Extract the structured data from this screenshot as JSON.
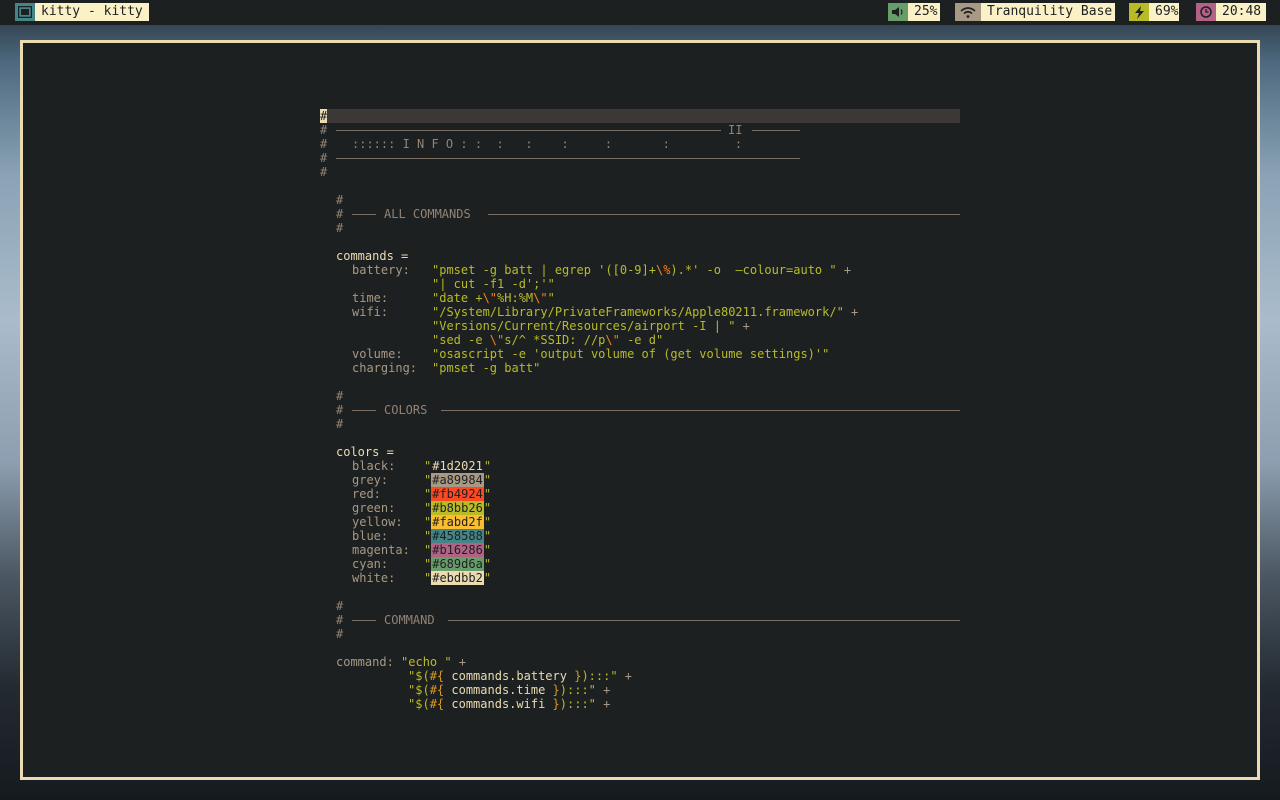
{
  "topbar": {
    "window_title": "kitty - kitty",
    "volume": "25%",
    "wifi": "Tranquility Base",
    "battery": "69%",
    "time": "20:48",
    "colors": {
      "bar": "#1d2021",
      "win_icon": "#458588",
      "volume": "#689d6a",
      "wifi": "#a89984",
      "battery": "#b8bb26",
      "clock": "#b16286",
      "label_bg": "#fbf1c7"
    }
  },
  "editor": {
    "cursor_char": "#",
    "hash": "#",
    "info_roman": "II",
    "info_text": ":::::: I N F O : :  :   :    :     :       :         :",
    "section_all": "ALL COMMANDS",
    "section_colors": "COLORS",
    "section_command": "COMMAND",
    "commands_decl": "commands =",
    "battery_key": "battery:",
    "battery_line1_a": "\"pmset -g batt | egrep '([0-9]+",
    "battery_line1_esc": "\\%",
    "battery_line1_b": ").*' -o  —colour=auto \"",
    "plus": "+",
    "battery_line2": "\"| cut -f1 -d';'\"",
    "time_key": "time:",
    "time_a": "\"date +",
    "time_esc1": "\\\"",
    "time_b": "%H:%M",
    "time_esc2": "\\\"",
    "time_c": "\"",
    "wifi_key": "wifi:",
    "wifi_line1": "\"/System/Library/PrivateFrameworks/Apple80211.framework/\"",
    "wifi_line2": "\"Versions/Current/Resources/airport -I | \"",
    "wifi_line3_a": "\"sed -e ",
    "wifi_line3_esc1": "\\\"",
    "wifi_line3_b": "s/^ *SSID: //p",
    "wifi_line3_esc2": "\\\"",
    "wifi_line3_c": " -e d\"",
    "volume_key": "volume:",
    "volume_val": "\"osascript -e 'output volume of (get volume settings)'\"",
    "charging_key": "charging:",
    "charging_val": "\"pmset -g batt\"",
    "colors_decl": "colors =",
    "color_entries": [
      {
        "key": "black:",
        "value": "#1d2021"
      },
      {
        "key": "grey:",
        "value": "#a89984"
      },
      {
        "key": "red:",
        "value": "#fb4924"
      },
      {
        "key": "green:",
        "value": "#b8bb26"
      },
      {
        "key": "yellow:",
        "value": "#fabd2f"
      },
      {
        "key": "blue:",
        "value": "#458588"
      },
      {
        "key": "magenta:",
        "value": "#b16286"
      },
      {
        "key": "cyan:",
        "value": "#689d6a"
      },
      {
        "key": "white:",
        "value": "#ebdbb2"
      }
    ],
    "quote": "\"",
    "command_key": "command:",
    "echo_val": "\"echo \"",
    "interp_open": "\"$(",
    "interp_hash": "#{",
    "interp_close_brace": "}",
    "interp_tail": "):::\"",
    "ref_battery": "commands.battery",
    "ref_time": "commands.time",
    "ref_wifi": "commands.wifi"
  }
}
